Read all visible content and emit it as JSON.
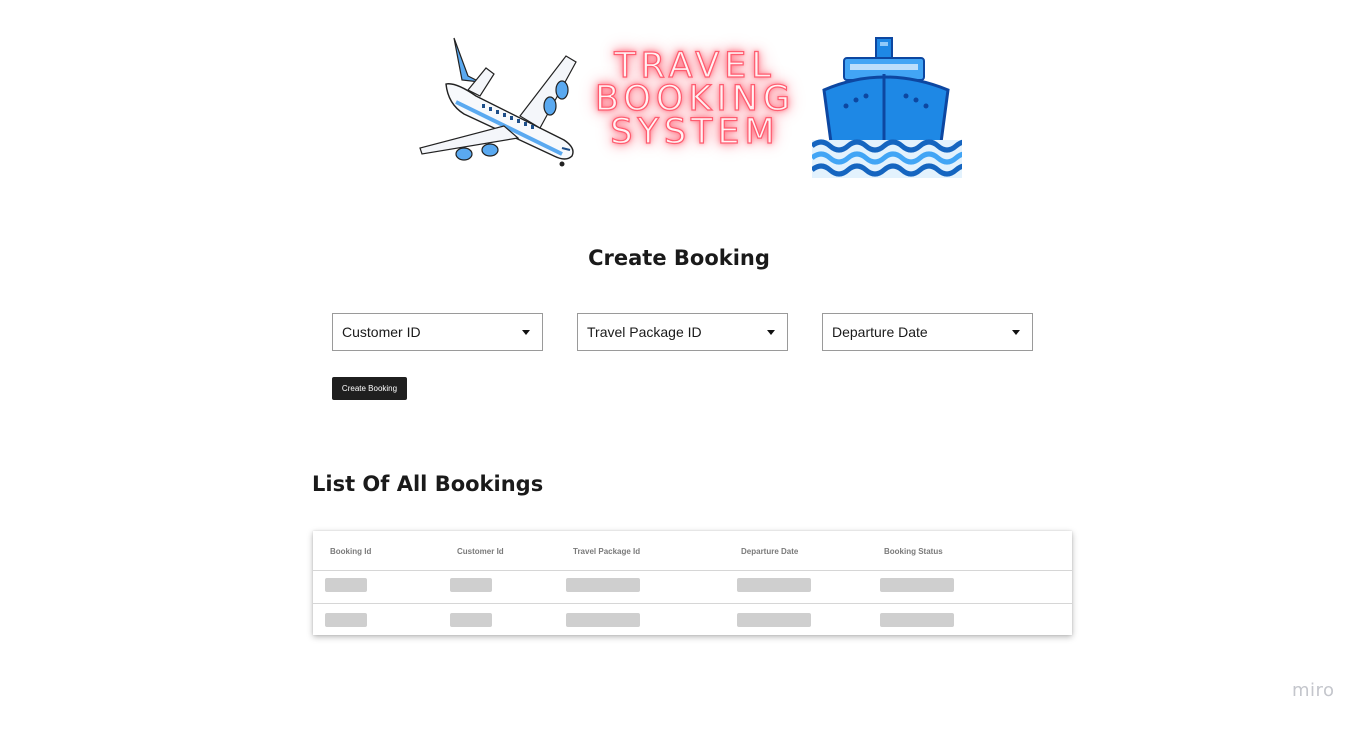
{
  "banner": {
    "title_lines": [
      "TRAVEL",
      "BOOKING",
      "SYSTEM"
    ],
    "neon_color": "#ff5c6f",
    "left_icon": "airplane-icon",
    "right_icon": "ship-icon"
  },
  "create_section": {
    "title": "Create Booking",
    "dropdowns": [
      {
        "label": "Customer ID"
      },
      {
        "label": "Travel Package ID"
      },
      {
        "label": "Departure Date"
      }
    ],
    "button_label": "Create Booking"
  },
  "list_section": {
    "title": "List Of All Bookings",
    "columns": [
      "Booking Id",
      "Customer Id",
      "Travel Package Id",
      "Departure Date",
      "Booking Status"
    ],
    "row_count_shown": 2
  },
  "watermark": "miro",
  "colors": {
    "button_bg": "#1f1f1f",
    "placeholder": "#cfcfcf",
    "ship_blue": "#1e88e5"
  }
}
